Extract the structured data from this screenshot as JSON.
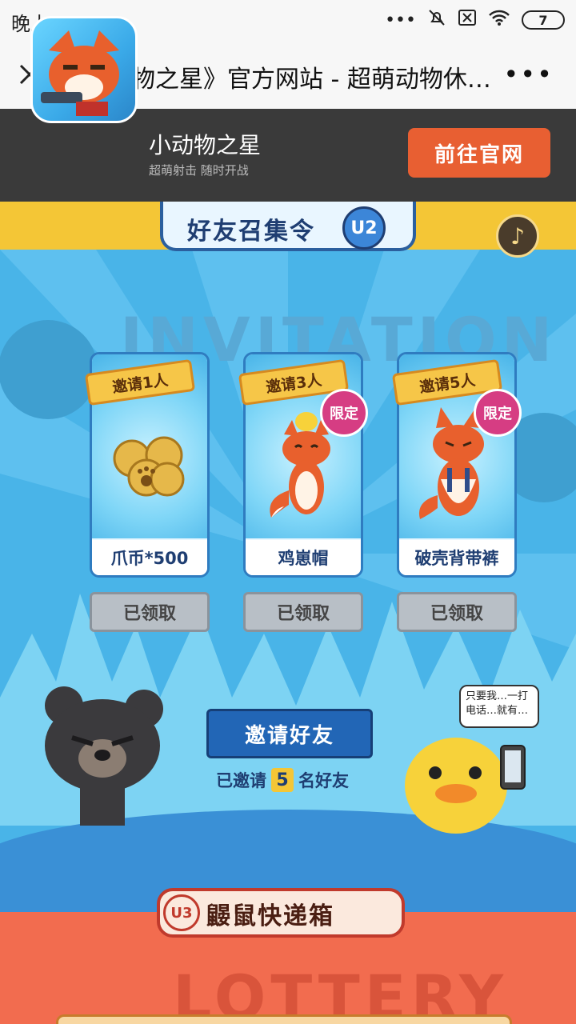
{
  "status_bar": {
    "time": "晚上11:10",
    "battery": "7"
  },
  "nav": {
    "title": "《小动物之星》官方网站 - 超萌动物休闲...",
    "more": "•••"
  },
  "app_banner": {
    "name": "小动物之星",
    "tagline": "超萌射击 随时开战",
    "visit_button": "前往官网"
  },
  "invite_section": {
    "title": "好友召集令",
    "badge": "U2",
    "watermark": "INVITATION",
    "rewards": [
      {
        "ticket": "邀请1人",
        "label": "爪币*500",
        "status": "已领取",
        "limited": ""
      },
      {
        "ticket": "邀请3人",
        "label": "鸡崽帽",
        "status": "已领取",
        "limited": "限定"
      },
      {
        "ticket": "邀请5人",
        "label": "破壳背带裤",
        "status": "已领取",
        "limited": "限定"
      }
    ],
    "invite_button": "邀请好友",
    "invited_prefix": "已邀请",
    "invited_count": "5",
    "invited_suffix": "名好友",
    "speech": "只要我…一打电话…就有…"
  },
  "lottery": {
    "badge": "U3",
    "title": "鼹鼠快递箱",
    "watermark": "LOTTERY"
  },
  "colors": {
    "banner_bg": "#3a3a3a",
    "visit_button": "#e85f32",
    "game_bg": "#49b4e8",
    "yellow": "#f4c636",
    "invite_button": "#2266b6",
    "lottery_bg": "#f26c4f"
  }
}
